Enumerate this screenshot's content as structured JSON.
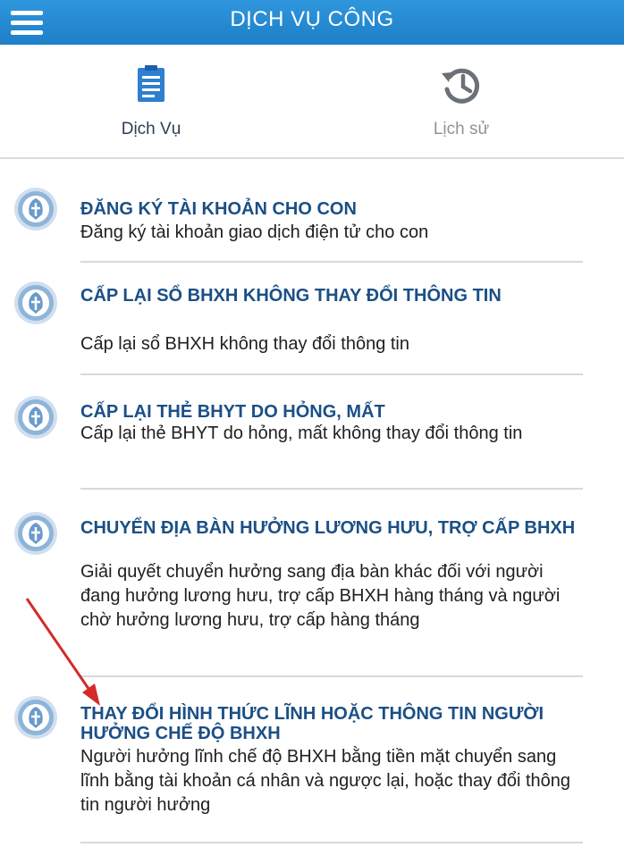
{
  "header": {
    "title": "DỊCH VỤ CÔNG",
    "menu_icon": "hamburger-menu-icon"
  },
  "tabs": [
    {
      "label": "Dịch Vụ",
      "icon": "document-icon"
    },
    {
      "label": "Lịch sử",
      "icon": "history-icon"
    }
  ],
  "services": [
    {
      "title": "ĐĂNG KÝ TÀI KHOẢN CHO CON",
      "description": "Đăng ký tài khoản giao dịch điện tử cho con"
    },
    {
      "title": "CẤP LẠI SỔ BHXH KHÔNG THAY ĐỔI THÔNG TIN",
      "description": "Cấp lại sổ BHXH không thay đổi thông tin"
    },
    {
      "title": "CẤP LẠI THẺ BHYT DO HỎNG, MẤT",
      "description": "Cấp lại thẻ BHYT do hỏng, mất không thay đổi thông tin"
    },
    {
      "title": "CHUYỂN ĐỊA BÀN HƯỞNG LƯƠNG HƯU, TRỢ CẤP BHXH",
      "description": "Giải quyết chuyển hưởng sang địa bàn khác đối với người đang hưởng lương hưu, trợ cấp BHXH hàng tháng và người chờ hưởng lương hưu, trợ cấp hàng tháng"
    },
    {
      "title": "THAY ĐỔI HÌNH THỨC LĨNH HOẶC THÔNG TIN NGƯỜI HƯỞNG CHẾ ĐỘ BHXH",
      "description": "Người hưởng lĩnh chế độ BHXH bằng tiền mặt chuyển sang lĩnh bằng tài khoản cá nhân và ngược lại, hoặc thay đổi thông tin người hưởng"
    }
  ],
  "colors": {
    "header": "#1d7fc8",
    "title": "#1b4f86",
    "arrow": "#d42a2a"
  }
}
